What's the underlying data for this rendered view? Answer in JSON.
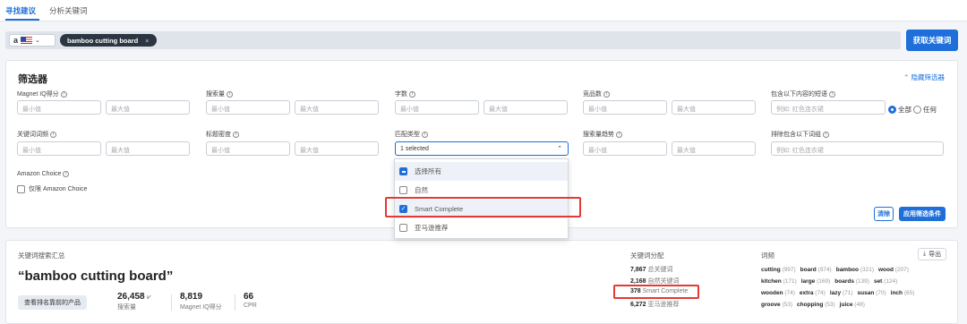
{
  "tabs": [
    "寻找建议",
    "分析关键词"
  ],
  "search": {
    "market_logo": "a",
    "keyword": "bamboo cutting board",
    "chip_close": "×",
    "submit_label": "获取关键词"
  },
  "filters": {
    "title": "筛选器",
    "hide_label": "隐藏筛选器",
    "labels": [
      "Magnet IQ得分",
      "搜索量",
      "字数",
      "竞品数",
      "包含以下内容的短语",
      "关键词词频",
      "标题密度",
      "匹配类型",
      "搜索量趋势",
      "排除包含以下词组",
      "Amazon Choice"
    ],
    "min_placeholder": "最小值",
    "max_placeholder": "最大值",
    "phrase_placeholder": "例如: 红色连衣裙",
    "radio_all": "全部",
    "radio_any": "任何",
    "match_type_value": "1 selected",
    "amazon_choice_checkbox": "仅限 Amazon Choice",
    "clear_label": "清除",
    "apply_label": "应用筛选条件"
  },
  "dropdown": {
    "items": [
      "选择所有",
      "自然",
      "Smart Complete",
      "亚马逊推荐"
    ],
    "checked": [
      false,
      false,
      true,
      false
    ],
    "indeterminate": [
      true,
      false,
      false,
      false
    ]
  },
  "summary": {
    "title": "关键词搜索汇总",
    "keyword": "“bamboo cutting board”",
    "view_products": "查看排名靠前的产品",
    "stats": [
      {
        "value": "26,458",
        "label": "搜索量"
      },
      {
        "value": "8,819",
        "label": "Magnet IQ得分"
      },
      {
        "value": "66",
        "label": "CPR"
      }
    ]
  },
  "distribution": {
    "title": "关键词分配",
    "rows": [
      {
        "value": "7,867",
        "label": "总关键词"
      },
      {
        "value": "2,168",
        "label": "自然关键词"
      },
      {
        "value": "378",
        "label": "Smart Complete"
      },
      {
        "value": "6,272",
        "label": "亚马逊推荐"
      }
    ]
  },
  "words": {
    "title": "词频",
    "export_label": "导出",
    "rows": [
      [
        {
          "w": "cutting",
          "c": "(997)"
        },
        {
          "w": "board",
          "c": "(974)"
        },
        {
          "w": "bamboo",
          "c": "(321)"
        },
        {
          "w": "wood",
          "c": "(207)"
        }
      ],
      [
        {
          "w": "kitchen",
          "c": "(171)"
        },
        {
          "w": "large",
          "c": "(169)"
        },
        {
          "w": "boards",
          "c": "(139)"
        },
        {
          "w": "set",
          "c": "(124)"
        }
      ],
      [
        {
          "w": "wooden",
          "c": "(74)"
        },
        {
          "w": "extra",
          "c": "(74)"
        },
        {
          "w": "lazy",
          "c": "(71)"
        },
        {
          "w": "susan",
          "c": "(70)"
        },
        {
          "w": "inch",
          "c": "(65)"
        }
      ],
      [
        {
          "w": "groove",
          "c": "(53)"
        },
        {
          "w": "chopping",
          "c": "(53)"
        },
        {
          "w": "juice",
          "c": "(48)"
        }
      ]
    ]
  },
  "colors": {
    "accent": "#1e6fd9",
    "highlight": "#e53935",
    "chip": "#2b3642"
  }
}
